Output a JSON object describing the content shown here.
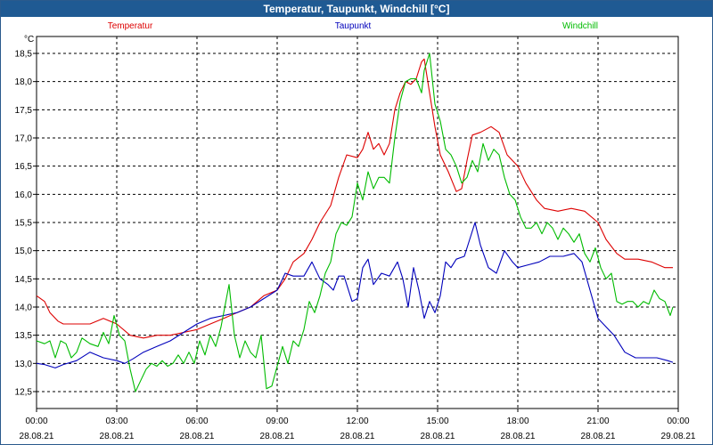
{
  "window": {
    "title": "Temperatur, Taupunkt, Windchill [°C]"
  },
  "colors": {
    "temperature": "#dd0000",
    "dewpoint": "#0000bb",
    "windchill": "#00bb00",
    "grid": "#000000"
  },
  "chart_data": {
    "type": "line",
    "title": "Temperatur, Taupunkt, Windchill [°C]",
    "ylabel": "°C",
    "grid": true,
    "legend_placement": "top",
    "ylim": [
      12.2,
      18.8
    ],
    "xlim_hours": [
      0,
      24
    ],
    "y_ticks": [
      "12,5",
      "13,0",
      "13,5",
      "14,0",
      "14,5",
      "15,0",
      "15,5",
      "16,0",
      "16,5",
      "17,0",
      "17,5",
      "18,0",
      "18,5"
    ],
    "x_ticks": [
      {
        "hour": 0,
        "time": "00:00",
        "date": "28.08.21"
      },
      {
        "hour": 3,
        "time": "03:00",
        "date": "28.08.21"
      },
      {
        "hour": 6,
        "time": "06:00",
        "date": "28.08.21"
      },
      {
        "hour": 9,
        "time": "09:00",
        "date": "28.08.21"
      },
      {
        "hour": 12,
        "time": "12:00",
        "date": "28.08.21"
      },
      {
        "hour": 15,
        "time": "15:00",
        "date": "28.08.21"
      },
      {
        "hour": 18,
        "time": "18:00",
        "date": "28.08.21"
      },
      {
        "hour": 21,
        "time": "21:00",
        "date": "28.08.21"
      },
      {
        "hour": 24,
        "time": "00:00",
        "date": "29.08.21"
      }
    ],
    "series": [
      {
        "name": "Temperatur",
        "color": "#dd0000",
        "points": [
          [
            0,
            14.2
          ],
          [
            0.3,
            14.1
          ],
          [
            0.5,
            13.9
          ],
          [
            0.8,
            13.75
          ],
          [
            1,
            13.7
          ],
          [
            1.5,
            13.7
          ],
          [
            2,
            13.7
          ],
          [
            2.5,
            13.8
          ],
          [
            3,
            13.7
          ],
          [
            3.5,
            13.5
          ],
          [
            4,
            13.45
          ],
          [
            4.5,
            13.5
          ],
          [
            5,
            13.5
          ],
          [
            5.5,
            13.55
          ],
          [
            6,
            13.6
          ],
          [
            6.5,
            13.7
          ],
          [
            7,
            13.8
          ],
          [
            7.5,
            13.9
          ],
          [
            8,
            14.0
          ],
          [
            8.5,
            14.2
          ],
          [
            9,
            14.3
          ],
          [
            9.3,
            14.5
          ],
          [
            9.6,
            14.8
          ],
          [
            10,
            14.95
          ],
          [
            10.3,
            15.2
          ],
          [
            10.6,
            15.5
          ],
          [
            11,
            15.8
          ],
          [
            11.3,
            16.3
          ],
          [
            11.6,
            16.7
          ],
          [
            12,
            16.65
          ],
          [
            12.2,
            16.8
          ],
          [
            12.4,
            17.1
          ],
          [
            12.6,
            16.8
          ],
          [
            12.8,
            16.9
          ],
          [
            13,
            16.7
          ],
          [
            13.2,
            16.9
          ],
          [
            13.4,
            17.5
          ],
          [
            13.6,
            17.8
          ],
          [
            13.8,
            18.0
          ],
          [
            14,
            17.95
          ],
          [
            14.2,
            18.05
          ],
          [
            14.4,
            18.35
          ],
          [
            14.5,
            18.4
          ],
          [
            14.7,
            17.8
          ],
          [
            14.9,
            17.2
          ],
          [
            15.1,
            16.7
          ],
          [
            15.4,
            16.4
          ],
          [
            15.7,
            16.05
          ],
          [
            15.9,
            16.1
          ],
          [
            16.1,
            16.6
          ],
          [
            16.3,
            17.05
          ],
          [
            16.6,
            17.1
          ],
          [
            17,
            17.2
          ],
          [
            17.3,
            17.1
          ],
          [
            17.6,
            16.7
          ],
          [
            18,
            16.5
          ],
          [
            18.3,
            16.2
          ],
          [
            18.7,
            15.9
          ],
          [
            19,
            15.75
          ],
          [
            19.5,
            15.7
          ],
          [
            20,
            15.75
          ],
          [
            20.5,
            15.7
          ],
          [
            21,
            15.5
          ],
          [
            21.3,
            15.2
          ],
          [
            21.7,
            14.95
          ],
          [
            22,
            14.85
          ],
          [
            22.5,
            14.85
          ],
          [
            23,
            14.8
          ],
          [
            23.5,
            14.7
          ],
          [
            23.8,
            14.7
          ]
        ]
      },
      {
        "name": "Taupunkt",
        "color": "#0000bb",
        "points": [
          [
            0,
            13.0
          ],
          [
            0.3,
            12.98
          ],
          [
            0.7,
            12.92
          ],
          [
            1,
            12.98
          ],
          [
            1.5,
            13.05
          ],
          [
            2,
            13.2
          ],
          [
            2.5,
            13.1
          ],
          [
            3,
            13.05
          ],
          [
            3.3,
            13.0
          ],
          [
            3.6,
            13.08
          ],
          [
            4,
            13.2
          ],
          [
            4.5,
            13.3
          ],
          [
            5,
            13.4
          ],
          [
            5.5,
            13.55
          ],
          [
            6,
            13.7
          ],
          [
            6.5,
            13.8
          ],
          [
            7,
            13.85
          ],
          [
            7.5,
            13.9
          ],
          [
            8,
            14.0
          ],
          [
            8.5,
            14.15
          ],
          [
            9,
            14.3
          ],
          [
            9.3,
            14.6
          ],
          [
            9.6,
            14.55
          ],
          [
            10,
            14.55
          ],
          [
            10.3,
            14.8
          ],
          [
            10.6,
            14.5
          ],
          [
            10.9,
            14.4
          ],
          [
            11.1,
            14.3
          ],
          [
            11.3,
            14.55
          ],
          [
            11.5,
            14.55
          ],
          [
            11.8,
            14.1
          ],
          [
            12,
            14.15
          ],
          [
            12.2,
            14.7
          ],
          [
            12.4,
            14.85
          ],
          [
            12.6,
            14.4
          ],
          [
            12.9,
            14.6
          ],
          [
            13.2,
            14.55
          ],
          [
            13.5,
            14.8
          ],
          [
            13.7,
            14.5
          ],
          [
            13.9,
            14.0
          ],
          [
            14.1,
            14.7
          ],
          [
            14.3,
            14.3
          ],
          [
            14.5,
            13.8
          ],
          [
            14.7,
            14.1
          ],
          [
            14.9,
            13.9
          ],
          [
            15.1,
            14.2
          ],
          [
            15.3,
            14.8
          ],
          [
            15.5,
            14.7
          ],
          [
            15.7,
            14.85
          ],
          [
            16,
            14.9
          ],
          [
            16.2,
            15.2
          ],
          [
            16.4,
            15.5
          ],
          [
            16.6,
            15.1
          ],
          [
            16.9,
            14.7
          ],
          [
            17.2,
            14.6
          ],
          [
            17.5,
            15.0
          ],
          [
            17.8,
            14.8
          ],
          [
            18,
            14.7
          ],
          [
            18.4,
            14.75
          ],
          [
            18.8,
            14.8
          ],
          [
            19.2,
            14.9
          ],
          [
            19.7,
            14.9
          ],
          [
            20.1,
            14.95
          ],
          [
            20.4,
            14.8
          ],
          [
            20.7,
            14.3
          ],
          [
            21,
            13.8
          ],
          [
            21.3,
            13.65
          ],
          [
            21.6,
            13.5
          ],
          [
            22,
            13.2
          ],
          [
            22.4,
            13.1
          ],
          [
            22.8,
            13.1
          ],
          [
            23.2,
            13.1
          ],
          [
            23.6,
            13.05
          ],
          [
            23.8,
            13.02
          ]
        ]
      },
      {
        "name": "Windchill",
        "color": "#00bb00",
        "points": [
          [
            0,
            13.4
          ],
          [
            0.3,
            13.35
          ],
          [
            0.5,
            13.4
          ],
          [
            0.7,
            13.1
          ],
          [
            0.9,
            13.4
          ],
          [
            1.1,
            13.35
          ],
          [
            1.3,
            13.1
          ],
          [
            1.5,
            13.2
          ],
          [
            1.7,
            13.45
          ],
          [
            2,
            13.35
          ],
          [
            2.3,
            13.3
          ],
          [
            2.5,
            13.55
          ],
          [
            2.7,
            13.35
          ],
          [
            2.9,
            13.85
          ],
          [
            3.1,
            13.5
          ],
          [
            3.3,
            13.4
          ],
          [
            3.5,
            12.9
          ],
          [
            3.7,
            12.5
          ],
          [
            3.9,
            12.7
          ],
          [
            4.1,
            12.9
          ],
          [
            4.3,
            13.0
          ],
          [
            4.5,
            12.95
          ],
          [
            4.7,
            13.05
          ],
          [
            4.9,
            12.95
          ],
          [
            5.1,
            13.0
          ],
          [
            5.3,
            13.15
          ],
          [
            5.5,
            13.0
          ],
          [
            5.7,
            13.2
          ],
          [
            5.9,
            13.0
          ],
          [
            6.1,
            13.4
          ],
          [
            6.3,
            13.15
          ],
          [
            6.5,
            13.5
          ],
          [
            6.7,
            13.3
          ],
          [
            6.9,
            13.65
          ],
          [
            7.2,
            14.4
          ],
          [
            7.4,
            13.5
          ],
          [
            7.6,
            13.1
          ],
          [
            7.8,
            13.4
          ],
          [
            8.0,
            13.2
          ],
          [
            8.2,
            13.1
          ],
          [
            8.4,
            13.5
          ],
          [
            8.6,
            12.55
          ],
          [
            8.8,
            12.6
          ],
          [
            9.0,
            12.95
          ],
          [
            9.2,
            13.3
          ],
          [
            9.4,
            13.0
          ],
          [
            9.6,
            13.4
          ],
          [
            9.8,
            13.3
          ],
          [
            10.0,
            13.6
          ],
          [
            10.2,
            14.1
          ],
          [
            10.4,
            13.9
          ],
          [
            10.6,
            14.2
          ],
          [
            10.8,
            14.6
          ],
          [
            11.0,
            14.8
          ],
          [
            11.2,
            15.3
          ],
          [
            11.4,
            15.5
          ],
          [
            11.6,
            15.45
          ],
          [
            11.8,
            15.6
          ],
          [
            12.0,
            16.2
          ],
          [
            12.2,
            15.9
          ],
          [
            12.4,
            16.4
          ],
          [
            12.6,
            16.1
          ],
          [
            12.8,
            16.3
          ],
          [
            13.0,
            16.3
          ],
          [
            13.2,
            16.2
          ],
          [
            13.4,
            17.0
          ],
          [
            13.6,
            17.65
          ],
          [
            13.8,
            18.0
          ],
          [
            14.0,
            18.05
          ],
          [
            14.2,
            18.05
          ],
          [
            14.4,
            17.8
          ],
          [
            14.5,
            18.2
          ],
          [
            14.7,
            18.5
          ],
          [
            14.9,
            17.6
          ],
          [
            15.1,
            17.3
          ],
          [
            15.3,
            16.8
          ],
          [
            15.5,
            16.7
          ],
          [
            15.7,
            16.5
          ],
          [
            15.9,
            16.2
          ],
          [
            16.1,
            16.3
          ],
          [
            16.3,
            16.6
          ],
          [
            16.5,
            16.4
          ],
          [
            16.7,
            16.9
          ],
          [
            16.9,
            16.6
          ],
          [
            17.1,
            16.8
          ],
          [
            17.3,
            16.7
          ],
          [
            17.5,
            16.3
          ],
          [
            17.7,
            16.0
          ],
          [
            17.9,
            15.9
          ],
          [
            18.1,
            15.6
          ],
          [
            18.3,
            15.4
          ],
          [
            18.5,
            15.4
          ],
          [
            18.7,
            15.5
          ],
          [
            18.9,
            15.3
          ],
          [
            19.1,
            15.5
          ],
          [
            19.3,
            15.4
          ],
          [
            19.5,
            15.2
          ],
          [
            19.7,
            15.4
          ],
          [
            19.9,
            15.3
          ],
          [
            20.1,
            15.15
          ],
          [
            20.3,
            15.3
          ],
          [
            20.5,
            14.95
          ],
          [
            20.7,
            14.8
          ],
          [
            20.9,
            15.05
          ],
          [
            21.1,
            14.7
          ],
          [
            21.3,
            14.5
          ],
          [
            21.5,
            14.6
          ],
          [
            21.7,
            14.1
          ],
          [
            21.9,
            14.05
          ],
          [
            22.1,
            14.1
          ],
          [
            22.3,
            14.1
          ],
          [
            22.5,
            14.0
          ],
          [
            22.7,
            14.1
          ],
          [
            22.9,
            14.05
          ],
          [
            23.1,
            14.3
          ],
          [
            23.3,
            14.15
          ],
          [
            23.5,
            14.1
          ],
          [
            23.7,
            13.85
          ],
          [
            23.8,
            14.0
          ]
        ]
      }
    ]
  }
}
